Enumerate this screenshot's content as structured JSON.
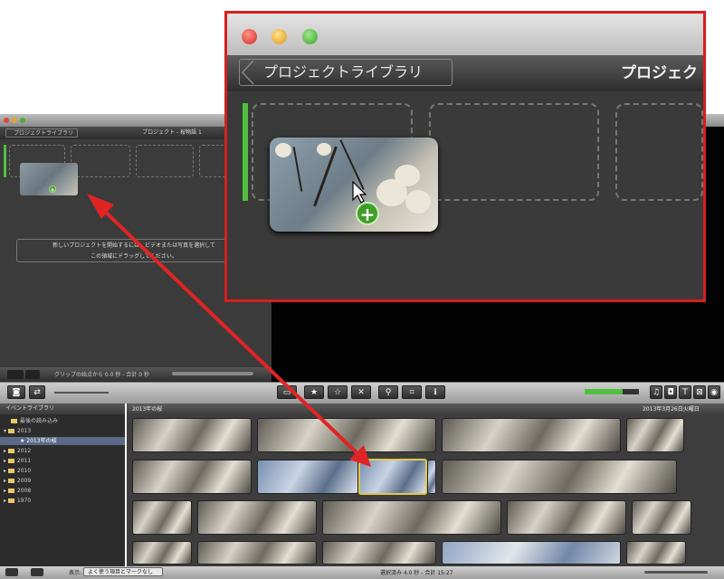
{
  "small_window": {
    "back_label": "プロジェクトライブラリ",
    "title": "プロジェクト - 桜物語 1",
    "message_line1": "新しいプロジェクトを開始するには、ビデオまたは写真を選択して",
    "message_line2": "この領域にドラッグしてください。",
    "status": "クリップの始点から 0.0 秒 - 合計 0 秒"
  },
  "event_library": {
    "header": "イベントライブラリ",
    "items": [
      {
        "label": "最後の読み込み"
      },
      {
        "label": "2013"
      },
      {
        "label": "2013年の桜"
      },
      {
        "label": "2012"
      },
      {
        "label": "2011"
      },
      {
        "label": "2010"
      },
      {
        "label": "2009"
      },
      {
        "label": "2008"
      },
      {
        "label": "1970"
      }
    ]
  },
  "browser": {
    "header_left": "2013年の桜",
    "header_right": "2013年3月26日火曜日"
  },
  "bottom": {
    "show_label": "表示:",
    "filter_value": "よく使う項目とマークなし",
    "status": "選択済み 4.0 秒 - 合計 15:27"
  },
  "zoom_panel": {
    "back_label": "プロジェクトライブラリ",
    "title": "プロジェク"
  },
  "toolbar_icons": [
    "camera-icon",
    "swap-icon",
    "star-icon",
    "empty-star-icon",
    "x-icon",
    "wand-icon",
    "crop-icon",
    "info-icon"
  ],
  "colors": {
    "highlight_border": "#d81e1e",
    "arrow": "#e02424",
    "selection": "#e0c84a",
    "add_badge": "#3f9e2a",
    "insertion_bar": "#4fbf3f"
  }
}
